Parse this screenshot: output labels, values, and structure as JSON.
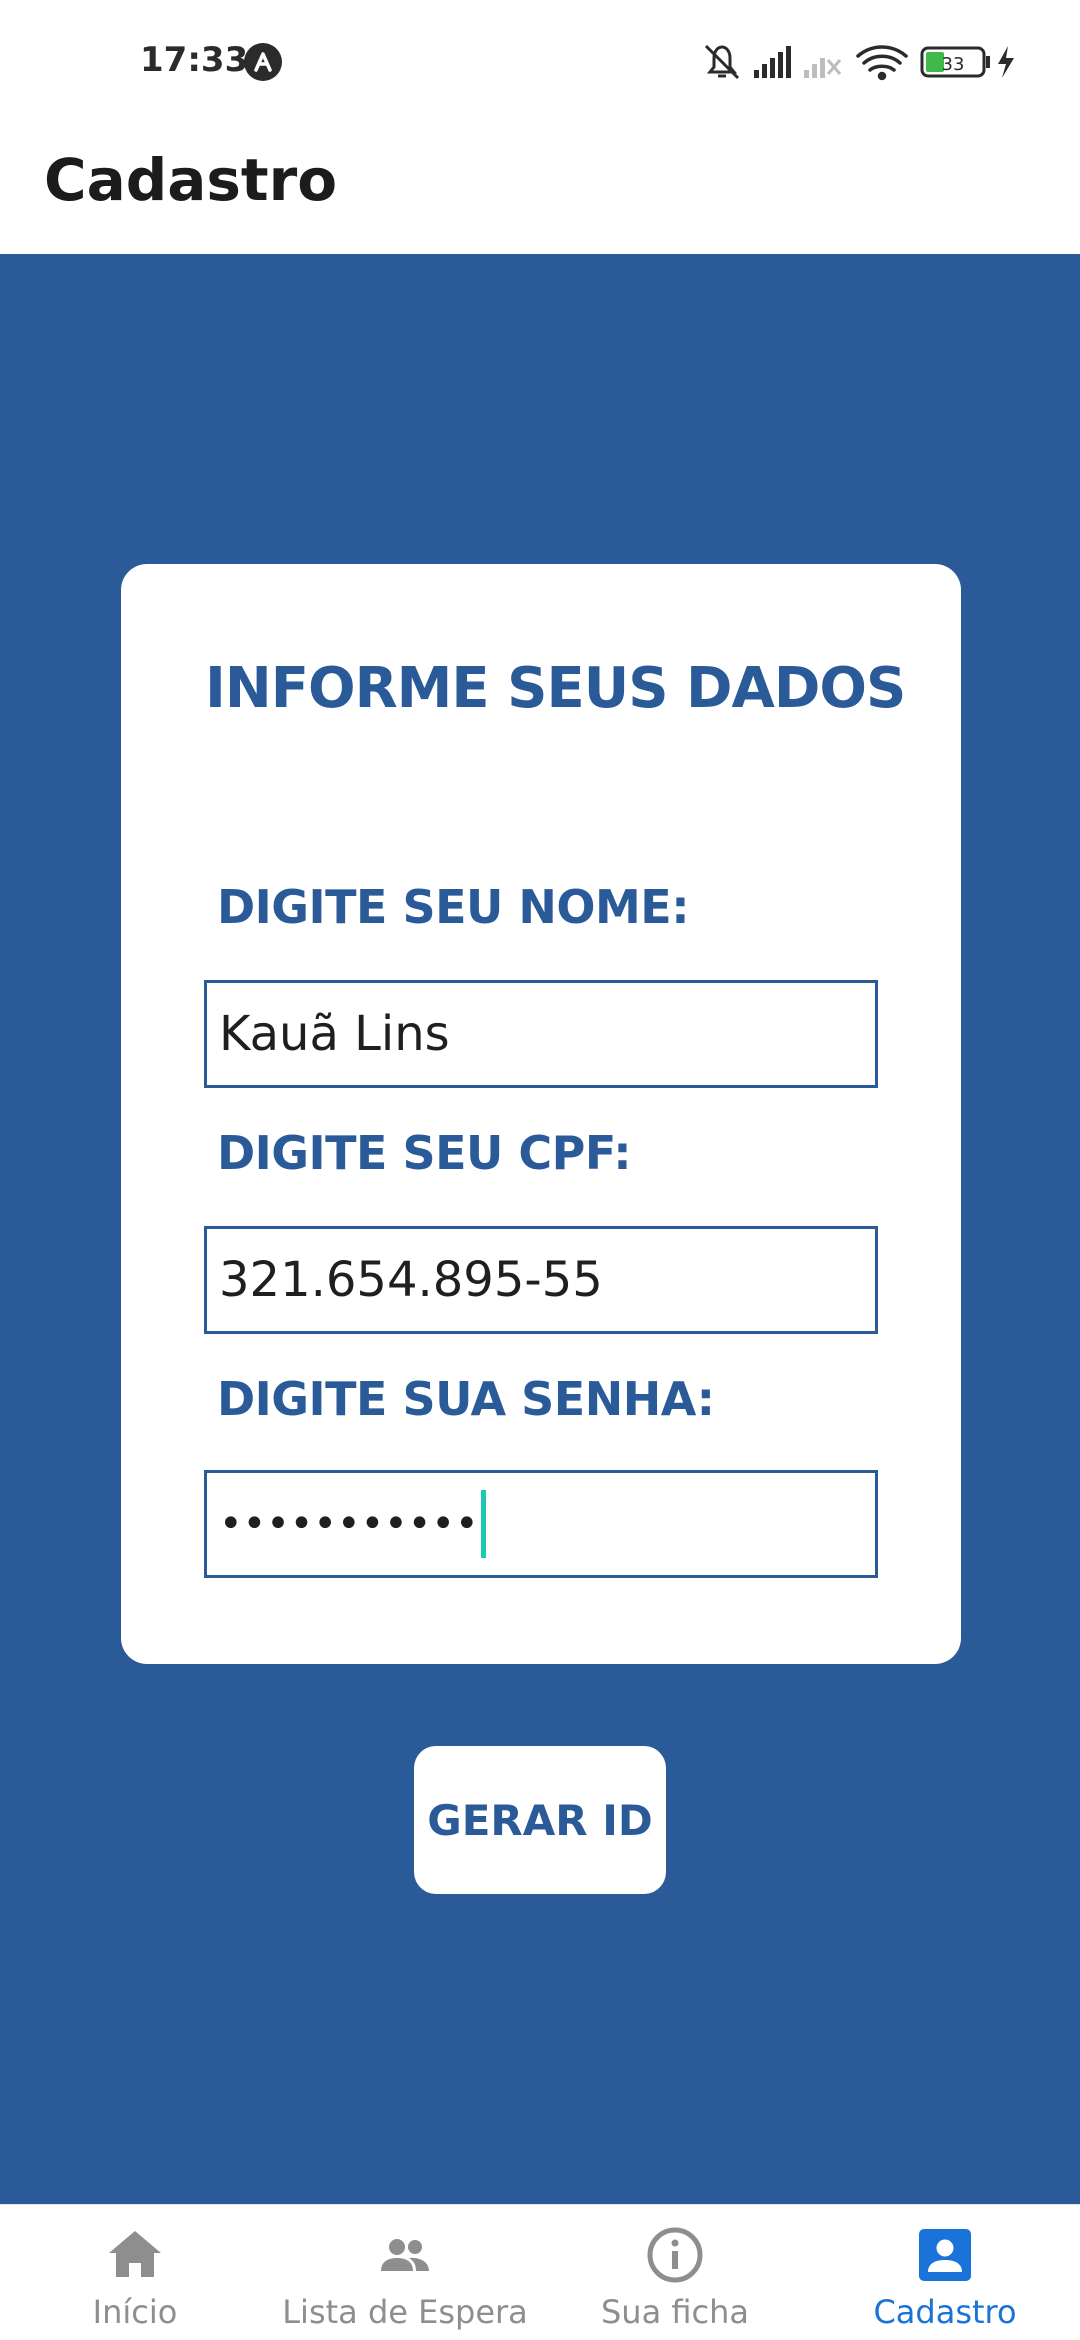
{
  "status_bar": {
    "time": "17:33",
    "battery_level": "33",
    "icons": [
      "app-notification-icon",
      "mute-icon",
      "signal-icon",
      "signal-no-sim-icon",
      "wifi-icon",
      "battery-icon",
      "charging-icon"
    ]
  },
  "app_bar": {
    "title": "Cadastro"
  },
  "form": {
    "title": "INFORME SEUS DADOS",
    "name_label": "DIGITE SEU NOME:",
    "name_value": "Kauã Lins",
    "cpf_label": "DIGITE SEU CPF:",
    "cpf_value": "321.654.895-55",
    "password_label": "DIGITE SUA SENHA:",
    "password_value": "•••••••••••",
    "submit_label": "GERAR ID"
  },
  "bottom_nav": {
    "items": [
      {
        "label": "Início",
        "icon": "home-icon",
        "active": false
      },
      {
        "label": "Lista de Espera",
        "icon": "people-icon",
        "active": false
      },
      {
        "label": "Sua ficha",
        "icon": "info-icon",
        "active": false
      },
      {
        "label": "Cadastro",
        "icon": "account-box-icon",
        "active": true
      }
    ]
  },
  "colors": {
    "primary": "#2a5b98",
    "active_tab": "#1a73d8",
    "inactive_tab": "#8e8e8e",
    "caret": "#19c9b4"
  }
}
